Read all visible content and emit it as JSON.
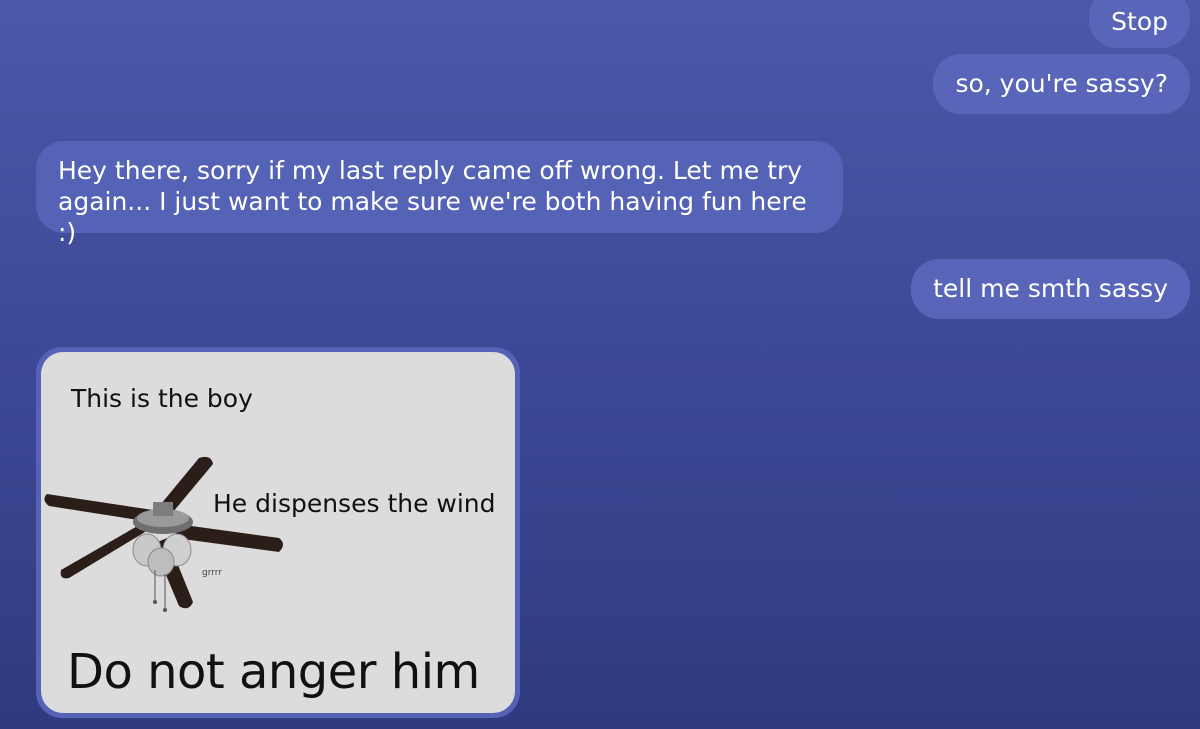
{
  "messages": [
    {
      "id": "stop",
      "direction": "sent",
      "text": "Stop"
    },
    {
      "id": "sassy-q",
      "direction": "sent",
      "text": "so, you're sassy?"
    },
    {
      "id": "apology",
      "direction": "received",
      "text": "Hey there, sorry if my last reply came off wrong. Let me try again... I just want to make sure we're both having fun here :)"
    },
    {
      "id": "tell",
      "direction": "sent",
      "text": "tell me smth sassy"
    }
  ],
  "meme": {
    "line1": "This is the boy",
    "line2": "He dispenses the wind",
    "grr": "grrrr",
    "line4": "Do not anger him",
    "icon": "ceiling-fan-image"
  },
  "colors": {
    "background_top": "#4a5aa8",
    "background_bottom": "#2f3a7f",
    "bubble": "#5865b8",
    "text": "#ffffff"
  }
}
